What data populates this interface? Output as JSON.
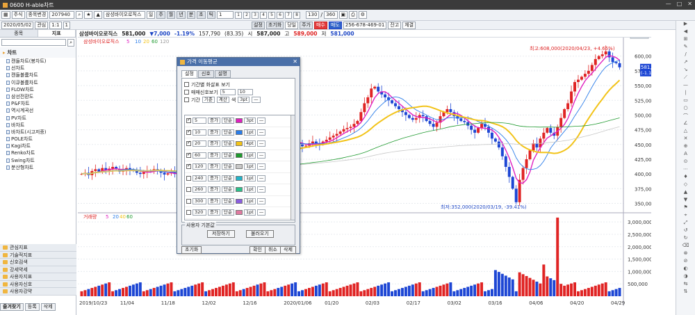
{
  "window": {
    "title": "0600 H-able차트"
  },
  "toolbar": {
    "menu": "주식",
    "stock_change": "종목변경",
    "code": "207940",
    "stock_name": "삼성바이오로직스",
    "period_btns": [
      "일",
      "주",
      "월",
      "년",
      "분",
      "초",
      "틱"
    ],
    "count": "1",
    "num_btns": [
      "1",
      "2",
      "3",
      "4",
      "5",
      "6",
      "7",
      "8"
    ],
    "view": "130",
    "total": "360"
  },
  "toolbar2": {
    "date": "2020/05/02",
    "interest": "관심",
    "ratio": "1:1",
    "ratio2": "1",
    "setting": "설정",
    "reset": "초기화",
    "today": "당일",
    "price": "주가",
    "buy": "매수",
    "sell": "매도",
    "account": "256-678-469-01",
    "balance": "잔고",
    "filled": "체결"
  },
  "sidebar": {
    "tabs": [
      "종목",
      "지표"
    ],
    "folder": "차트",
    "items": [
      "캔들차트(봉차트)",
      "선차트",
      "캔들볼륨차트",
      "이큐볼륨차트",
      "FLOW차트",
      "삼선전환도",
      "P&F차트",
      "역시계곡선",
      "PV차트",
      "바차트",
      "바차트(시고저종)",
      "POLE차트",
      "Kagi차트",
      "Renko차트",
      "Swing차트",
      "분산형차트"
    ],
    "bottom_list": [
      "관심지표",
      "기술적지표",
      "신호검색",
      "강세약세",
      "사용자지표",
      "사용자신호",
      "사용자강약"
    ],
    "bottom_tabs": [
      "즐겨찾기",
      "등록",
      "삭제"
    ]
  },
  "info": {
    "name": "삼성바이오로직스",
    "price": "581,000",
    "change": "▼7,000",
    "pct": "-1.19%",
    "volume": "157,790",
    "rate": "(83.35)",
    "open_label": "시",
    "open": "587,000",
    "high_label": "고",
    "high": "589,000",
    "low_label": "저",
    "low": "581,000"
  },
  "chart_legend": {
    "name": "삼성바이오로직스",
    "ma": [
      "5",
      "10",
      "20",
      "60",
      "120"
    ],
    "volume_label": "거래량",
    "vol_ma": [
      "5",
      "20",
      "40",
      "60"
    ]
  },
  "annotations": {
    "high": "최고:608,000(2020/04/23, +4.65%)",
    "low": "최저:352,000(2020/03/19, -39.41%)",
    "cur_price": "581,000",
    "cur_pct": "(-1.19%)",
    "right_tab": "일봉"
  },
  "axes": {
    "price_ticks": [
      "600,000",
      "575,000",
      "550,000",
      "525,000",
      "500,000",
      "475,000",
      "450,000",
      "425,000",
      "400,000",
      "375,000",
      "350,000"
    ],
    "vol_ticks": [
      "3,000,000",
      "2,500,000",
      "2,000,000",
      "1,500,000",
      "1,000,000",
      "500,000"
    ],
    "dates": [
      "2019/10/23",
      "11/04",
      "11/18",
      "12/02",
      "12/16",
      "2020/01/06",
      "01/20",
      "02/03",
      "02/17",
      "03/02",
      "03/16",
      "04/06",
      "04/20",
      "04/29"
    ]
  },
  "dialog": {
    "title": "가격 이동평균",
    "tabs": [
      "설정",
      "신호",
      "설명"
    ],
    "opt1": "기간별 화살표 보기",
    "opt2": "매매신호보기",
    "opt2_a": "5",
    "opt2_b": "10",
    "opt3": "기간",
    "opt3_a": "기준",
    "opt3_b": "계산",
    "opt3_c": "색",
    "opt3_d": "3pt",
    "rows": [
      {
        "n": "5",
        "src": "종가",
        "type": "단순",
        "color": "#e020c0",
        "w": "3pt",
        "on": true
      },
      {
        "n": "10",
        "src": "종가",
        "type": "단순",
        "color": "#2b7de9",
        "w": "1pt",
        "on": true
      },
      {
        "n": "20",
        "src": "종가",
        "type": "단순",
        "color": "#f2c318",
        "w": "4pt",
        "on": true
      },
      {
        "n": "60",
        "src": "종가",
        "type": "단순",
        "color": "#1f9a2f",
        "w": "1pt",
        "on": true
      },
      {
        "n": "120",
        "src": "종가",
        "type": "단순",
        "color": "#c8c8c8",
        "w": "1pt",
        "on": true
      },
      {
        "n": "240",
        "src": "종가",
        "type": "단순",
        "color": "#23b3c8",
        "w": "1pt",
        "on": false
      },
      {
        "n": "260",
        "src": "종가",
        "type": "단순",
        "color": "#2bbf8a",
        "w": "1pt",
        "on": false
      },
      {
        "n": "300",
        "src": "종가",
        "type": "단순",
        "color": "#8a5de0",
        "w": "1pt",
        "on": false
      },
      {
        "n": "320",
        "src": "종가",
        "type": "단순",
        "color": "#e07aa0",
        "w": "1pt",
        "on": false
      },
      {
        "n": "360",
        "src": "종가",
        "type": "단순",
        "color": "#2b5aa8",
        "w": "1pt",
        "on": false
      }
    ],
    "user_label": "사용자 기본값",
    "save": "저장하기",
    "load": "불러오기",
    "reset": "초기화",
    "ok": "확인",
    "cancel": "취소",
    "delete": "삭제"
  },
  "chart_data": {
    "type": "candlestick",
    "title": "삼성바이오로직스",
    "ylim": [
      340000,
      615000
    ],
    "vol_ylim": [
      0,
      3200000
    ],
    "closes": [
      400,
      402,
      398,
      405,
      408,
      404,
      410,
      406,
      409,
      412,
      408,
      404,
      406,
      410,
      408,
      405,
      402,
      400,
      403,
      406,
      404,
      408,
      405,
      402,
      399,
      401,
      403,
      400,
      398,
      396,
      395,
      393,
      391,
      394,
      396,
      398,
      397,
      400,
      402,
      404,
      407,
      410,
      415,
      418,
      422,
      426,
      430,
      428,
      432,
      436,
      440,
      438,
      442,
      446,
      448,
      450,
      453,
      450,
      447,
      452,
      458,
      455,
      452,
      450,
      447,
      448,
      452,
      455,
      452,
      450,
      455,
      458,
      462,
      465,
      468,
      472,
      476,
      478,
      480,
      485,
      490,
      505,
      520,
      530,
      545,
      548,
      540,
      535,
      530,
      525,
      520,
      515,
      510,
      505,
      500,
      495,
      492,
      495,
      500,
      498,
      490,
      485,
      480,
      487,
      498,
      505,
      510,
      505,
      498,
      494,
      490,
      488,
      482,
      475,
      470,
      478,
      485,
      480,
      470,
      460,
      455,
      445,
      430,
      412,
      395,
      375,
      352,
      390,
      410,
      425,
      440,
      452,
      445,
      460,
      470,
      478,
      470,
      465,
      480,
      495,
      510,
      520,
      540,
      556,
      560,
      565,
      570,
      575,
      585,
      595,
      600,
      603,
      608,
      598,
      590,
      588,
      581
    ]
  }
}
